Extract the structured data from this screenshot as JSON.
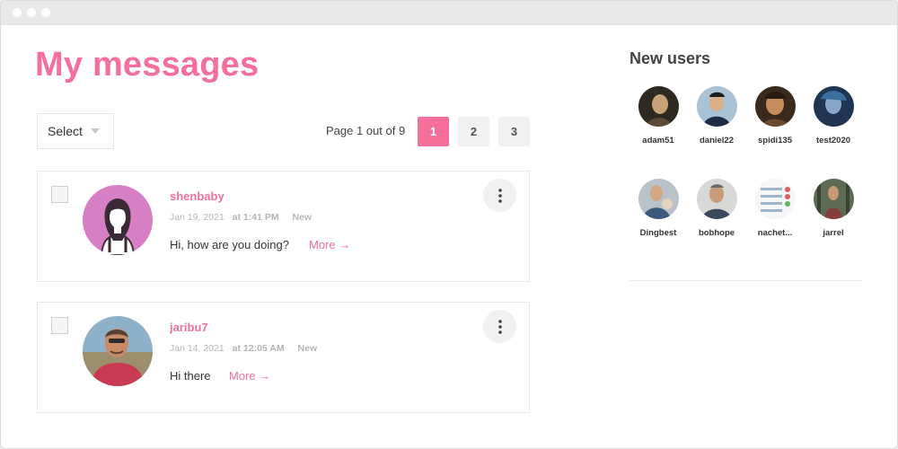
{
  "page": {
    "title": "My messages"
  },
  "filter": {
    "select_label": "Select"
  },
  "pagination": {
    "info": "Page 1 out of 9",
    "pages": [
      "1",
      "2",
      "3"
    ],
    "current": "1"
  },
  "messages": [
    {
      "username": "shenbaby",
      "date": "Jan 19, 2021",
      "time": "at 1:41 PM",
      "status": "New",
      "preview": "Hi, how are you doing?",
      "more_label": "More"
    },
    {
      "username": "jaribu7",
      "date": "Jan 14, 2021",
      "time": "at 12:05 AM",
      "status": "New",
      "preview": "Hi there",
      "more_label": "More"
    }
  ],
  "sidebar": {
    "title": "New users",
    "users": [
      {
        "name": "adam51"
      },
      {
        "name": "daniel22"
      },
      {
        "name": "spidi135"
      },
      {
        "name": "test2020"
      },
      {
        "name": "Dingbest"
      },
      {
        "name": "bobhope"
      },
      {
        "name": "nachet..."
      },
      {
        "name": "jarrel"
      }
    ]
  },
  "colors": {
    "accent": "#f46f9a",
    "text": "#333333",
    "muted": "#b5b5b5",
    "button_bg": "#f1f1f1"
  },
  "icons": [
    "kebab-menu-icon",
    "arrow-right-icon",
    "chevron-down-icon",
    "user-silhouette-icon"
  ]
}
